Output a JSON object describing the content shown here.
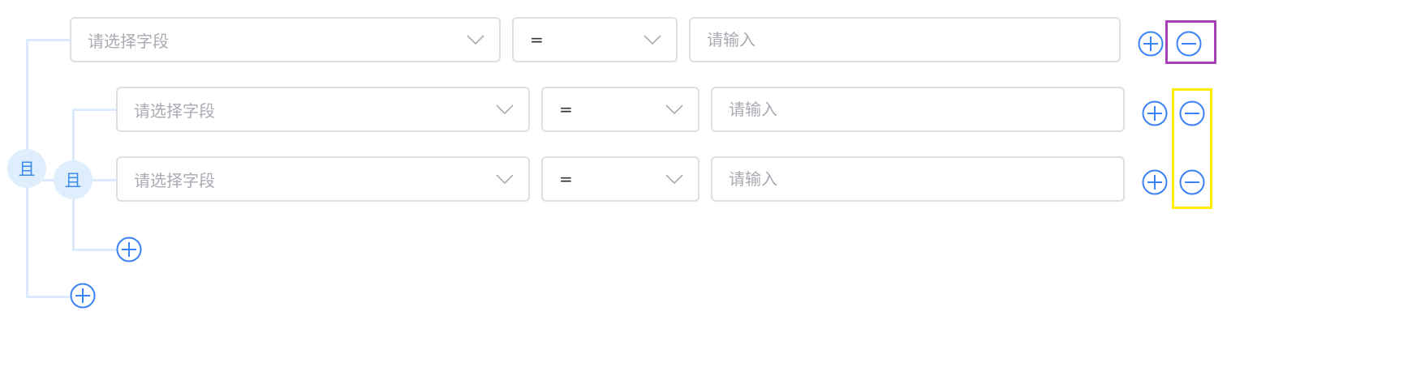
{
  "root_group": {
    "logic_label": "且",
    "conditions": [
      {
        "field_placeholder": "请选择字段",
        "operator": "=",
        "value_placeholder": "请输入"
      }
    ],
    "sub_group": {
      "logic_label": "且",
      "conditions": [
        {
          "field_placeholder": "请选择字段",
          "operator": "=",
          "value_placeholder": "请输入"
        },
        {
          "field_placeholder": "请选择字段",
          "operator": "=",
          "value_placeholder": "请输入"
        }
      ]
    }
  },
  "colors": {
    "accent": "#3b82f6",
    "connector": "#dbeafc",
    "badge_bg": "#dfeefd",
    "highlight_purple": "#a63fb8",
    "highlight_yellow": "#ffee00"
  }
}
